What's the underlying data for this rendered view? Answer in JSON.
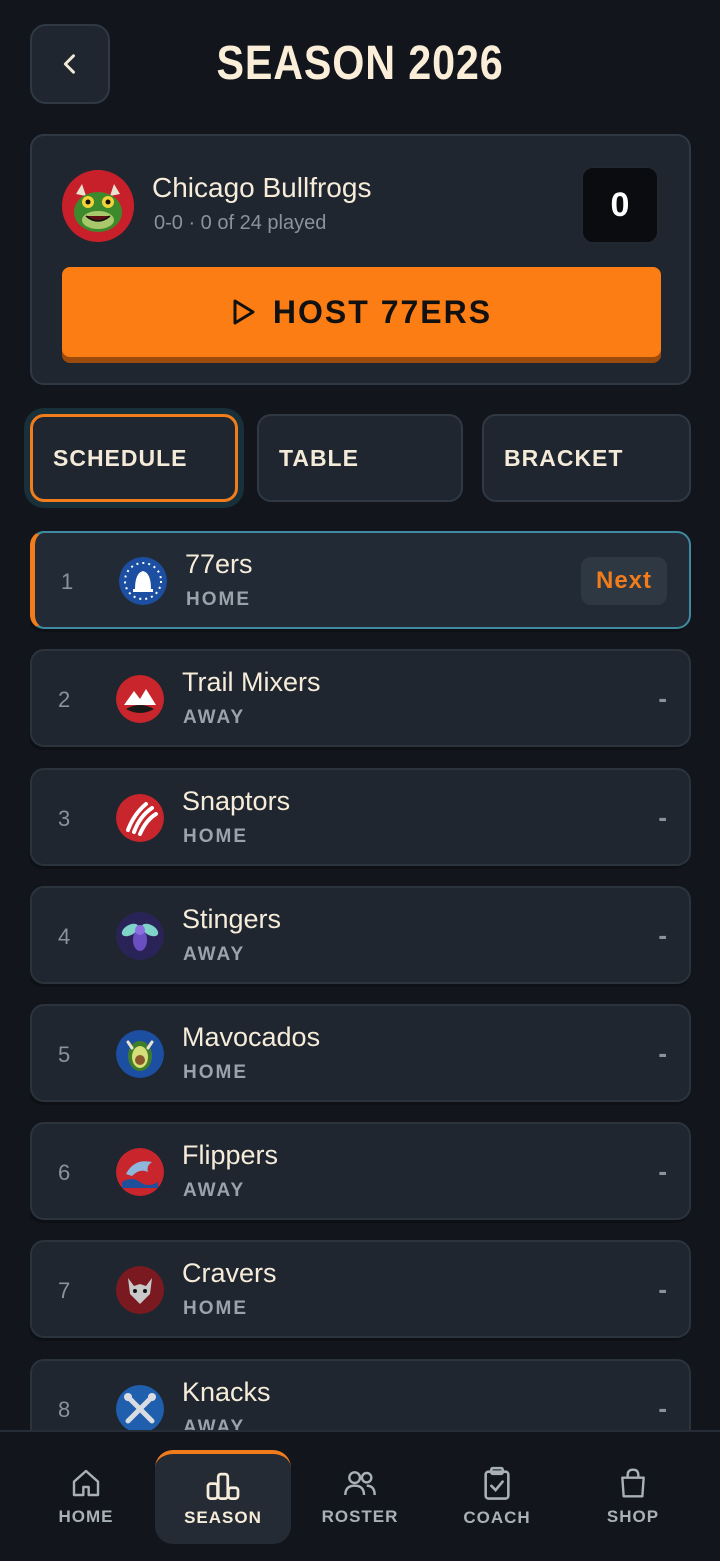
{
  "header": {
    "title": "SEASON 2026"
  },
  "team": {
    "name": "Chicago Bullfrogs",
    "record": "0-0 · 0 of 24 played",
    "score": "0",
    "host_label": "HOST 77ERS"
  },
  "tabs": [
    {
      "label": "SCHEDULE"
    },
    {
      "label": "TABLE"
    },
    {
      "label": "BRACKET"
    }
  ],
  "schedule": [
    {
      "num": "1",
      "name": "77ers",
      "venue": "HOME",
      "badge": "Next",
      "logo": "liberty-bell-icon",
      "color": "#1c4fa1"
    },
    {
      "num": "2",
      "name": "Trail Mixers",
      "venue": "AWAY",
      "result": "-",
      "logo": "mountain-icon",
      "color": "#c8252c"
    },
    {
      "num": "3",
      "name": "Snaptors",
      "venue": "HOME",
      "result": "-",
      "logo": "claw-icon",
      "color": "#c8252c"
    },
    {
      "num": "4",
      "name": "Stingers",
      "venue": "AWAY",
      "result": "-",
      "logo": "hornet-icon",
      "color": "#2a2358"
    },
    {
      "num": "5",
      "name": "Mavocados",
      "venue": "HOME",
      "result": "-",
      "logo": "avocado-icon",
      "color": "#1c4fa1"
    },
    {
      "num": "6",
      "name": "Flippers",
      "venue": "AWAY",
      "result": "-",
      "logo": "dolphin-icon",
      "color": "#c8252c"
    },
    {
      "num": "7",
      "name": "Cravers",
      "venue": "HOME",
      "result": "-",
      "logo": "wolf-icon",
      "color": "#7a1a20"
    },
    {
      "num": "8",
      "name": "Knacks",
      "venue": "AWAY",
      "result": "-",
      "logo": "wrench-icon",
      "color": "#1f5fae"
    }
  ],
  "nav": [
    {
      "label": "HOME",
      "icon": "home-icon"
    },
    {
      "label": "SEASON",
      "icon": "podium-icon",
      "active": true
    },
    {
      "label": "ROSTER",
      "icon": "users-icon"
    },
    {
      "label": "COACH",
      "icon": "clipboard-icon"
    },
    {
      "label": "SHOP",
      "icon": "bag-icon"
    }
  ],
  "colors": {
    "accent": "#fb7d14",
    "background": "#12161c",
    "card": "#1f2630",
    "highlight_border": "#3f8aa0"
  }
}
